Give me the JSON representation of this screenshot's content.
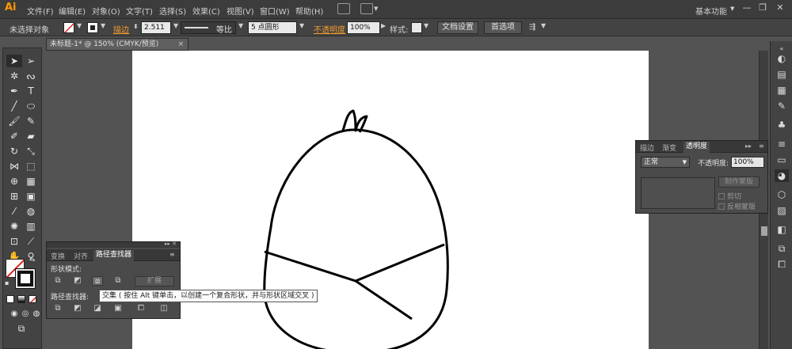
{
  "app": {
    "logo": "Ai",
    "workspace": "基本功能"
  },
  "menu": [
    "文件(F)",
    "编辑(E)",
    "对象(O)",
    "文字(T)",
    "选择(S)",
    "效果(C)",
    "视图(V)",
    "窗口(W)",
    "帮助(H)"
  ],
  "window_buttons": [
    "—",
    "❐",
    "✕"
  ],
  "control_bar": {
    "selection": "未选择对象",
    "stroke_label": "描边",
    "stroke_value": "2.511",
    "stroke_profile": "等比",
    "brush": "5 点圆形",
    "opacity_label": "不透明度",
    "opacity_value": "100%",
    "style_label": "样式:",
    "doc_setup": "文档设置",
    "preferences": "首选项"
  },
  "document_tab": {
    "title": "未标题-1* @ 150% (CMYK/预览)",
    "close": "×"
  },
  "colors": {
    "stroke_accent": "#f29a2e",
    "fill_swatch": "#ffffff",
    "no_fill_slash": "#e0201f"
  },
  "transparency_panel": {
    "tabs": [
      "描边",
      "渐变",
      "透明度"
    ],
    "blend_mode": "正常",
    "opacity_label": "不透明度:",
    "opacity_value": "100%",
    "make_mask": "制作蒙版",
    "clip": "剪切",
    "invert_mask": "反相蒙版"
  },
  "pathfinder_panel": {
    "tabs": [
      "变换",
      "对齐",
      "路径查找器"
    ],
    "shape_modes_label": "形状模式:",
    "pathfinders_label": "路径查找器:",
    "expand": "扩展",
    "tooltip": "交集 ( 按住 Alt 键单击，以创建一个复合形状，并与形状区域交叉 )"
  },
  "icons": [
    "selection-tool-icon",
    "direct-selection-tool-icon",
    "magic-wand-icon",
    "lasso-icon",
    "pen-icon",
    "type-icon",
    "line-icon",
    "ellipse-icon",
    "paintbrush-icon",
    "pencil-icon",
    "blob-brush-icon",
    "eraser-icon",
    "rotate-icon",
    "scale-icon",
    "width-icon",
    "free-transform-icon",
    "shape-builder-icon",
    "perspective-grid-icon",
    "mesh-icon",
    "gradient-icon",
    "eyedropper-icon",
    "blend-icon",
    "symbol-sprayer-icon",
    "column-graph-icon",
    "artboard-icon",
    "slice-icon",
    "hand-icon",
    "zoom-icon"
  ]
}
